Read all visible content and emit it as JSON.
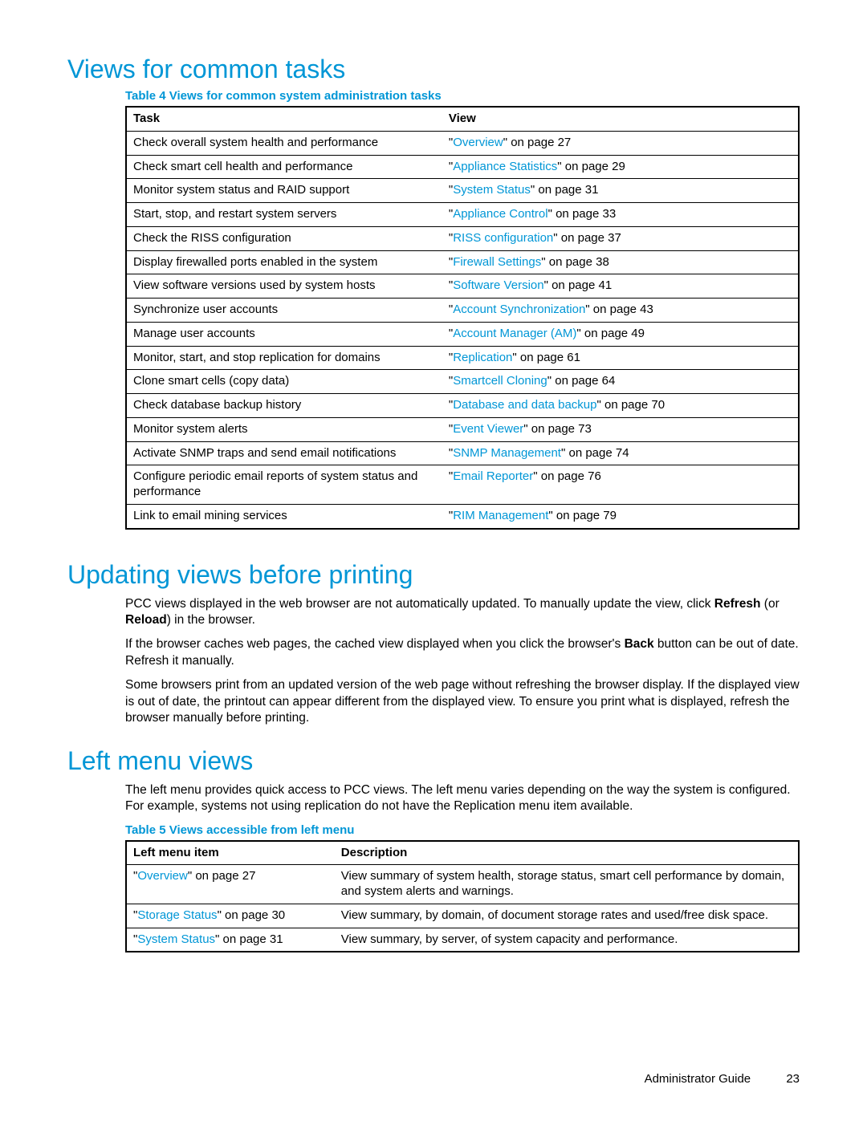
{
  "section1": {
    "heading": "Views for common tasks",
    "table_caption": "Table 4 Views for common system administration tasks",
    "headers": {
      "task": "Task",
      "view": "View"
    },
    "rows": [
      {
        "task": "Check overall system health and performance",
        "link": "Overview",
        "page": "27"
      },
      {
        "task": "Check smart cell health and performance",
        "link": "Appliance Statistics",
        "page": "29"
      },
      {
        "task": "Monitor system status and RAID support",
        "link": "System Status",
        "page": "31"
      },
      {
        "task": "Start, stop, and restart system servers",
        "link": "Appliance Control",
        "page": "33"
      },
      {
        "task": "Check the RISS configuration",
        "link": "RISS configuration",
        "page": "37"
      },
      {
        "task": "Display firewalled ports enabled in the system",
        "link": "Firewall Settings",
        "page": "38"
      },
      {
        "task": "View software versions used by system hosts",
        "link": "Software Version",
        "page": "41"
      },
      {
        "task": "Synchronize user accounts",
        "link": "Account Synchronization",
        "page": "43"
      },
      {
        "task": "Manage user accounts",
        "link": "Account Manager (AM)",
        "page": "49"
      },
      {
        "task": "Monitor, start, and stop replication for domains",
        "link": "Replication",
        "page": "61"
      },
      {
        "task": "Clone smart cells (copy data)",
        "link": "Smartcell Cloning",
        "page": "64"
      },
      {
        "task": "Check database backup history",
        "link": "Database and data backup",
        "page": "70"
      },
      {
        "task": "Monitor system alerts",
        "link": "Event Viewer",
        "page": "73"
      },
      {
        "task": "Activate SNMP traps and send email notifications",
        "link": "SNMP Management",
        "page": "74"
      },
      {
        "task": "Configure periodic email reports of system status and performance",
        "link": "Email Reporter",
        "page": "76"
      },
      {
        "task": "Link to email mining services",
        "link": "RIM Management",
        "page": "79"
      }
    ]
  },
  "section2": {
    "heading": "Updating views before printing",
    "p1a": "PCC views displayed in the web browser are not automatically updated.  To manually update the view, click ",
    "p1b": "Refresh",
    "p1c": " (or ",
    "p1d": "Reload",
    "p1e": ") in the browser.",
    "p2a": "If the browser caches web pages, the cached view displayed when you click the browser's ",
    "p2b": "Back",
    "p2c": " button can be out of date.  Refresh it manually.",
    "p3": "Some browsers print from an updated version of the web page without refreshing the browser display.  If the displayed view is out of date, the printout can appear different from the displayed view.  To ensure you print what is displayed, refresh the browser manually before printing."
  },
  "section3": {
    "heading": "Left menu views",
    "intro": "The left menu provides quick access to PCC views.  The left menu varies depending on the way the system is configured.  For example, systems not using replication do not have the Replication menu item available.",
    "table_caption": "Table 5 Views accessible from left menu",
    "headers": {
      "item": "Left menu item",
      "desc": "Description"
    },
    "rows": [
      {
        "link": "Overview",
        "page": "27",
        "desc": "View summary of system health, storage status, smart cell performance by domain, and system alerts and warnings."
      },
      {
        "link": "Storage Status",
        "page": "30",
        "desc": "View summary, by domain, of document storage rates and used/free disk space."
      },
      {
        "link": "System Status",
        "page": "31",
        "desc": "View summary, by server, of system capacity and performance."
      }
    ]
  },
  "footer": {
    "label": "Administrator Guide",
    "page": "23"
  },
  "strings": {
    "on_page": " on page ",
    "q": "\""
  }
}
